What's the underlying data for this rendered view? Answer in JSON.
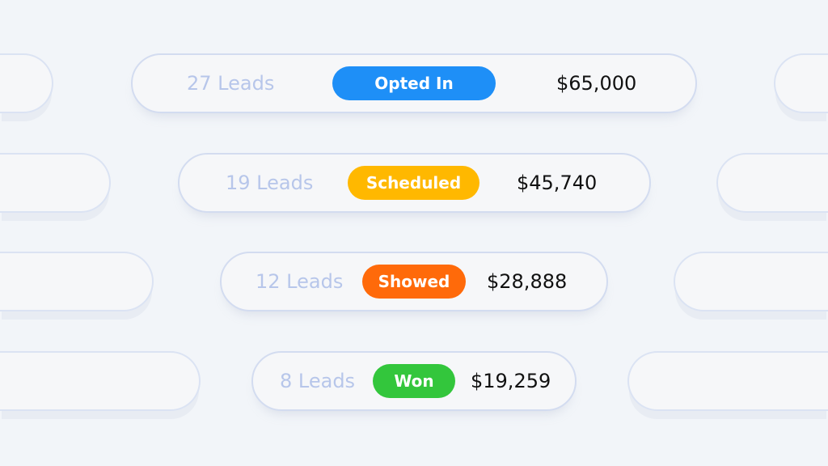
{
  "rows": [
    {
      "leads": "27 Leads",
      "status": "Opted In",
      "amount": "$65,000",
      "color": "#1e8ff7"
    },
    {
      "leads": "19 Leads",
      "status": "Scheduled",
      "amount": "$45,740",
      "color": "#ffb800"
    },
    {
      "leads": "12 Leads",
      "status": "Showed",
      "amount": "$28,888",
      "color": "#ff6a0a"
    },
    {
      "leads": "8 Leads",
      "status": "Won",
      "amount": "$19,259",
      "color": "#33c63c"
    }
  ]
}
